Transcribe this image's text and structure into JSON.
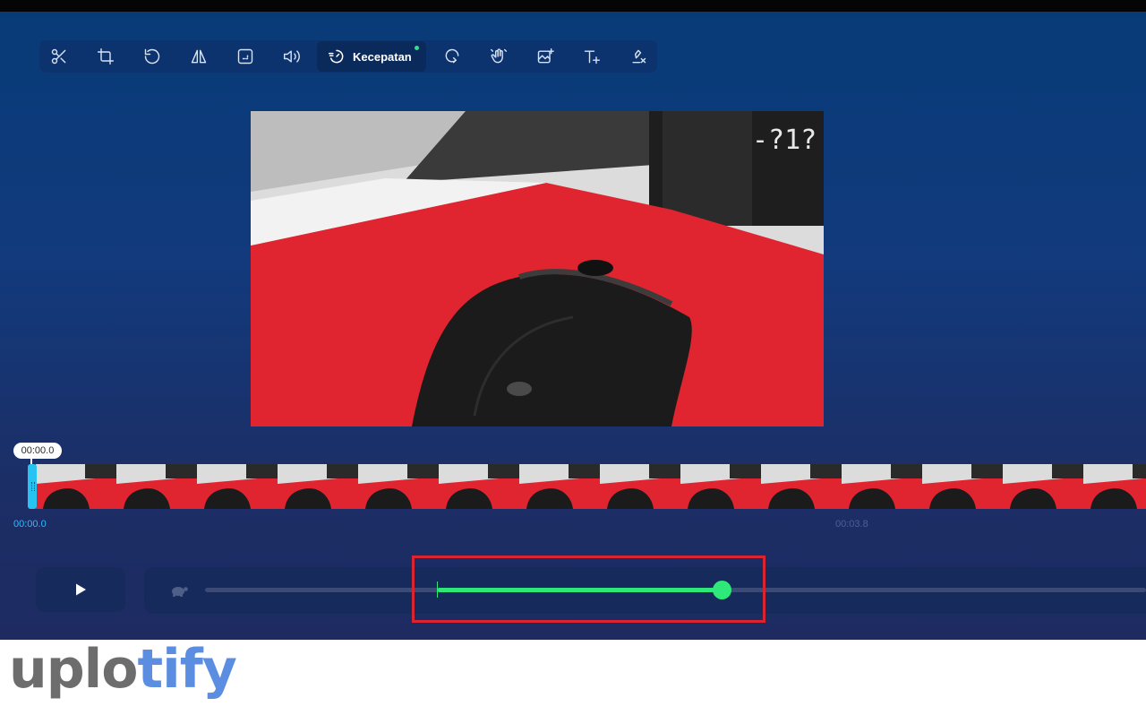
{
  "toolbar": {
    "tools": [
      {
        "icon": "scissors-icon",
        "label": ""
      },
      {
        "icon": "crop-icon",
        "label": ""
      },
      {
        "icon": "rotate-icon",
        "label": ""
      },
      {
        "icon": "flip-icon",
        "label": ""
      },
      {
        "icon": "resize-icon",
        "label": ""
      },
      {
        "icon": "volume-icon",
        "label": ""
      },
      {
        "icon": "speed-icon",
        "label": "Kecepatan",
        "active": true
      },
      {
        "icon": "loop-icon",
        "label": ""
      },
      {
        "icon": "stabilize-icon",
        "label": ""
      },
      {
        "icon": "add-image-icon",
        "label": ""
      },
      {
        "icon": "add-text-icon",
        "label": ""
      },
      {
        "icon": "remove-watermark-icon",
        "label": ""
      }
    ]
  },
  "timeline": {
    "playhead_time": "00:00.0",
    "start_label": "00:00.0",
    "mid_label": "00:03.8"
  },
  "controls": {
    "play_icon": "play-icon",
    "slow_icon": "turtle-icon",
    "speed_slider_position": 0.55
  },
  "colors": {
    "accent": "#2ee87a",
    "highlight": "#d8252f",
    "playhead": "#27c4f2"
  },
  "watermark": {
    "part1": "uplo",
    "part2": "tify"
  }
}
